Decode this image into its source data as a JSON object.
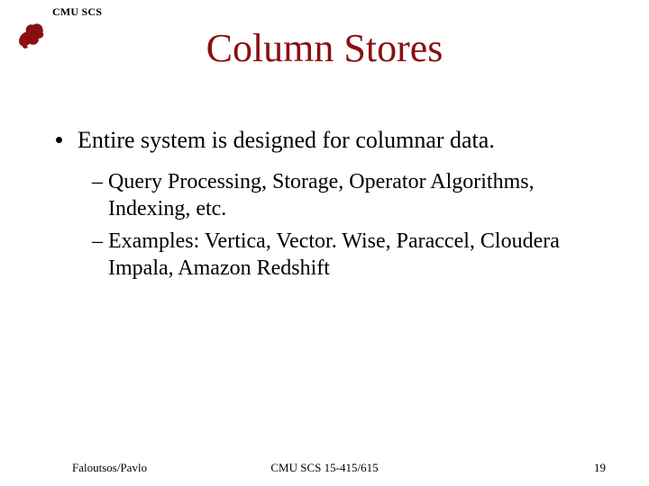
{
  "header": {
    "org_label": "CMU SCS"
  },
  "title": "Column Stores",
  "bullets": {
    "main": "Entire system is designed for columnar data.",
    "sub1": "Query Processing, Storage, Operator Algorithms, Indexing, etc.",
    "sub2": "Examples: Vertica, Vector. Wise, Paraccel, Cloudera Impala, Amazon Redshift"
  },
  "footer": {
    "left": "Faloutsos/Pavlo",
    "center": "CMU SCS 15-415/615",
    "page": "19"
  }
}
